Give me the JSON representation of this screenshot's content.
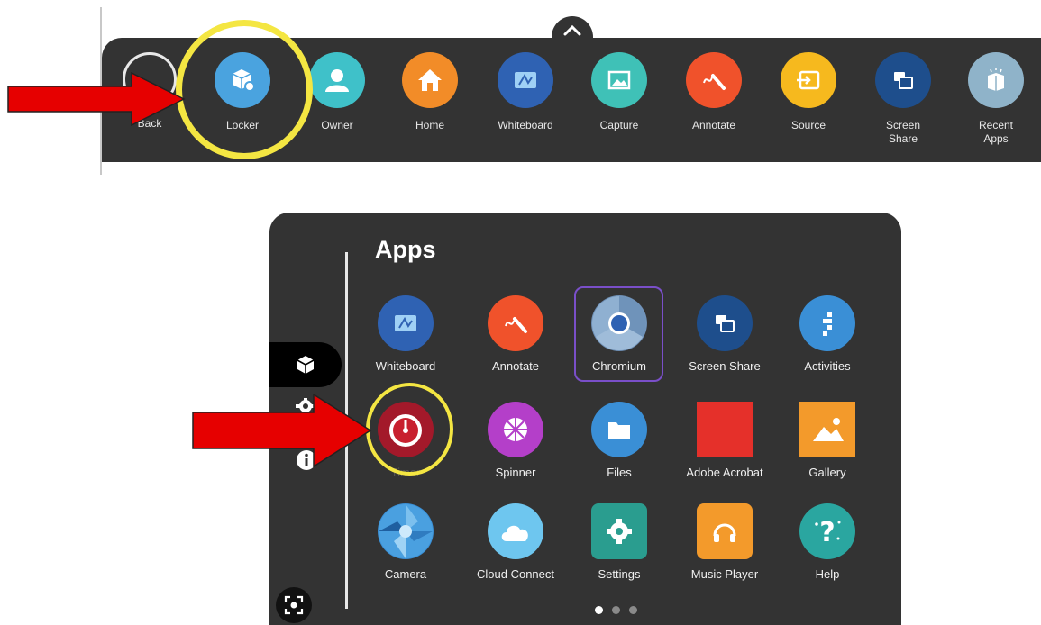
{
  "toolbar": {
    "items": [
      {
        "label": "Back",
        "icon": "back-icon"
      },
      {
        "label": "Locker",
        "icon": "locker-icon",
        "color": "#4aa3df"
      },
      {
        "label": "Owner",
        "icon": "owner-icon",
        "color": "#3fc1c9"
      },
      {
        "label": "Home",
        "icon": "home-icon",
        "color": "#f28c28"
      },
      {
        "label": "Whiteboard",
        "icon": "whiteboard-icon",
        "color": "#2f62b3"
      },
      {
        "label": "Capture",
        "icon": "capture-icon",
        "color": "#3fc1b7"
      },
      {
        "label": "Annotate",
        "icon": "annotate-icon",
        "color": "#f0522b"
      },
      {
        "label": "Source",
        "icon": "source-icon",
        "color": "#f6b91e"
      },
      {
        "label": "Screen\nShare",
        "icon": "screen-share-icon",
        "color": "#1e4e8c"
      },
      {
        "label": "Recent\nApps",
        "icon": "recent-apps-icon",
        "color": "#8fb3c9"
      }
    ]
  },
  "apps": {
    "title": "Apps",
    "items": [
      {
        "label": "Whiteboard",
        "icon": "whiteboard-icon",
        "color": "#2f62b3"
      },
      {
        "label": "Annotate",
        "icon": "annotate-icon",
        "color": "#f0522b"
      },
      {
        "label": "Chromium",
        "icon": "chromium-icon",
        "color": "#6e8fb5"
      },
      {
        "label": "Screen Share",
        "icon": "screen-share-icon",
        "color": "#1e4e8c"
      },
      {
        "label": "Activities",
        "icon": "activities-icon",
        "color": "#3a8fd6"
      },
      {
        "label": "Timer",
        "icon": "timer-icon",
        "color": "#a3192a"
      },
      {
        "label": "Spinner",
        "icon": "spinner-icon",
        "color": "#b43fc9"
      },
      {
        "label": "Files",
        "icon": "files-icon",
        "color": "#3a8fd6"
      },
      {
        "label": "Adobe Acrobat",
        "icon": "acrobat-icon",
        "color": "#e5302a"
      },
      {
        "label": "Gallery",
        "icon": "gallery-icon",
        "color": "#f39a2b"
      },
      {
        "label": "Camera",
        "icon": "camera-icon",
        "color": "#3a8fd6"
      },
      {
        "label": "Cloud Connect",
        "icon": "cloud-icon",
        "color": "#6ec6ef"
      },
      {
        "label": "Settings",
        "icon": "settings-icon",
        "color": "#2a9d8f"
      },
      {
        "label": "Music Player",
        "icon": "music-icon",
        "color": "#f39a2b"
      },
      {
        "label": "Help",
        "icon": "help-icon",
        "color": "#2aa6a0"
      }
    ],
    "page": 1,
    "pages": 3
  },
  "annotations": {
    "highlight_color": "#f4e642",
    "arrow_color": "#e60000"
  }
}
